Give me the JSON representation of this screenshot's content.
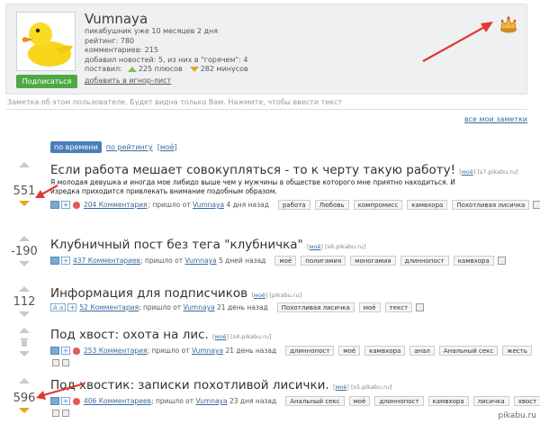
{
  "profile": {
    "username": "Vumnaya",
    "stats": [
      "пикабушник уже 10 месяцев 2 дня",
      "рейтинг: 780",
      "комментариев: 215",
      "добавил новостей: 5, из них в \"горячем\": 4"
    ],
    "votes_label": "поставил:",
    "plus_text": "225 плюсов",
    "minus_text": "282 минусов",
    "subscribe_label": "Подписаться",
    "ignore_label": "добавить в игнор-лист"
  },
  "note_placeholder": "Заметка об этом пользователе. Будет видна только Вам. Нажмите, чтобы ввести текст",
  "all_notes_label": "все мои заметки",
  "sort": {
    "by_time": "по времени",
    "by_rating": "по рейтингу",
    "mine": "моё"
  },
  "posts": [
    {
      "rating": "551",
      "title": "Если работа мешает совокупляться - то к черту такую работу!",
      "mine": "моё",
      "source": "[s7.pikabu.ru]",
      "text": "Я молодая девушка и иногда мое либидо выше чем у мужчины в обществе которого мне приятно находиться. И изредка приходится привлекать внимание подобным образом.",
      "comments": "204 Комментария",
      "posted_prefix": "; пришло от",
      "author": "Vumnaya",
      "time": "4 дня назад",
      "tags": [
        "работа",
        "Любовь",
        "компромисс",
        "камвхора",
        "Похотливая лисичка"
      ]
    },
    {
      "rating": "-190",
      "title": "Клубничный пост без тега \"клубничка\"",
      "mine": "моё",
      "source": "[s6.pikabu.ru]",
      "comments": "437 Комментариев",
      "posted_prefix": "; пришло от",
      "author": "Vumnaya",
      "time": "5 дней назад",
      "tags": [
        "моё",
        "полигамия",
        "моногамия",
        "длиннопост",
        "камвхора"
      ]
    },
    {
      "rating": "112",
      "title": "Информация для подписчиков",
      "mine": "моё",
      "source": "[pikabu.ru]",
      "comments": "52 Комментария",
      "posted_prefix": "; пришло от",
      "author": "Vumnaya",
      "time": "21 день назад",
      "tags": [
        "Похотливая лисичка",
        "моё",
        "текст"
      ]
    },
    {
      "rating": "",
      "title": "Под хвост: охота на лис.",
      "mine": "моё",
      "source": "[s4.pikabu.ru]",
      "comments": "253 Комментария",
      "posted_prefix": "; пришло от",
      "author": "Vumnaya",
      "time": "21 день назад",
      "tags": [
        "длиннопост",
        "моё",
        "камвхора",
        "анал",
        "Анальный секс",
        "жесть"
      ]
    },
    {
      "rating": "596",
      "title": "Под хвостик: записки похотливой лисички.",
      "mine": "моё",
      "source": "[s5.pikabu.ru]",
      "comments": "406 Комментариев",
      "posted_prefix": "; пришло от",
      "author": "Vumnaya",
      "time": "23 дня назад",
      "tags": [
        "Анальный секс",
        "моё",
        "длиннопост",
        "камвхора",
        "лисичка",
        "хвост"
      ]
    }
  ],
  "watermark": "pikabu.ru",
  "colors": {
    "accent": "#4a7ebb",
    "subscribe": "#4ea944",
    "plus": "#7fc24c",
    "minus": "#e3a620",
    "arrow": "#e03a2e"
  }
}
